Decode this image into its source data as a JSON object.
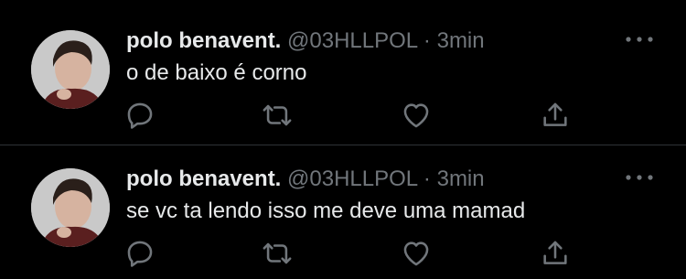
{
  "colors": {
    "background": "#000000",
    "text_primary": "#e7e9ea",
    "text_secondary": "#71767b",
    "divider": "#2f3336"
  },
  "tweets": [
    {
      "author_name": "polo benavent.",
      "author_handle": "@03HLLPOL",
      "separator": "·",
      "time": "3min",
      "text": "o de baixo é corno",
      "avatar_icon": "profile-photo",
      "actions": [
        "reply-icon",
        "retweet-icon",
        "like-icon",
        "share-icon"
      ]
    },
    {
      "author_name": "polo benavent.",
      "author_handle": "@03HLLPOL",
      "separator": "·",
      "time": "3min",
      "text": "se vc ta lendo isso me deve uma mamad",
      "avatar_icon": "profile-photo",
      "actions": [
        "reply-icon",
        "retweet-icon",
        "like-icon",
        "share-icon"
      ]
    }
  ]
}
